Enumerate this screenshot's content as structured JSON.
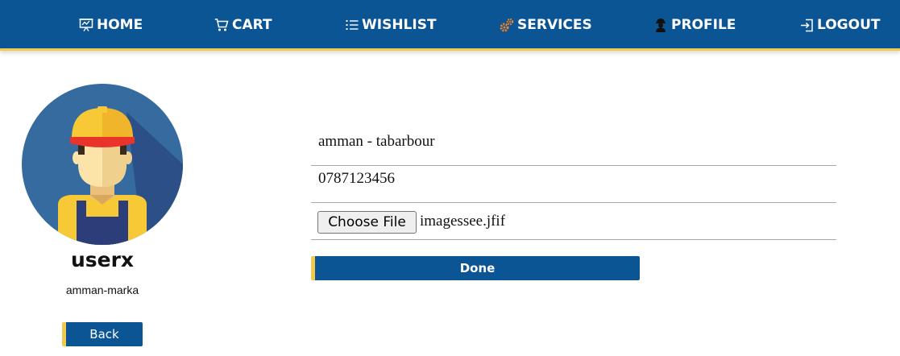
{
  "nav": {
    "items": [
      {
        "label": "HOME",
        "icon": "presentation-icon"
      },
      {
        "label": "CART",
        "icon": "cart-icon"
      },
      {
        "label": "WISHLIST",
        "icon": "list-icon"
      },
      {
        "label": "SERVICES",
        "icon": "gears-icon"
      },
      {
        "label": "PROFILE",
        "icon": "worker-icon"
      },
      {
        "label": "LOGOUT",
        "icon": "logout-icon"
      }
    ]
  },
  "colors": {
    "nav_bg": "#0b5595",
    "accent": "#f2c94c",
    "services_icon": "#f5821f"
  },
  "profile": {
    "username": "userx",
    "location": "amman-marka",
    "back_label": "Back"
  },
  "form": {
    "address": "amman - tabarbour",
    "phone": "0787123456",
    "choose_file_label": "Choose File",
    "file_name": "imagessee.jfif",
    "done_label": "Done"
  }
}
